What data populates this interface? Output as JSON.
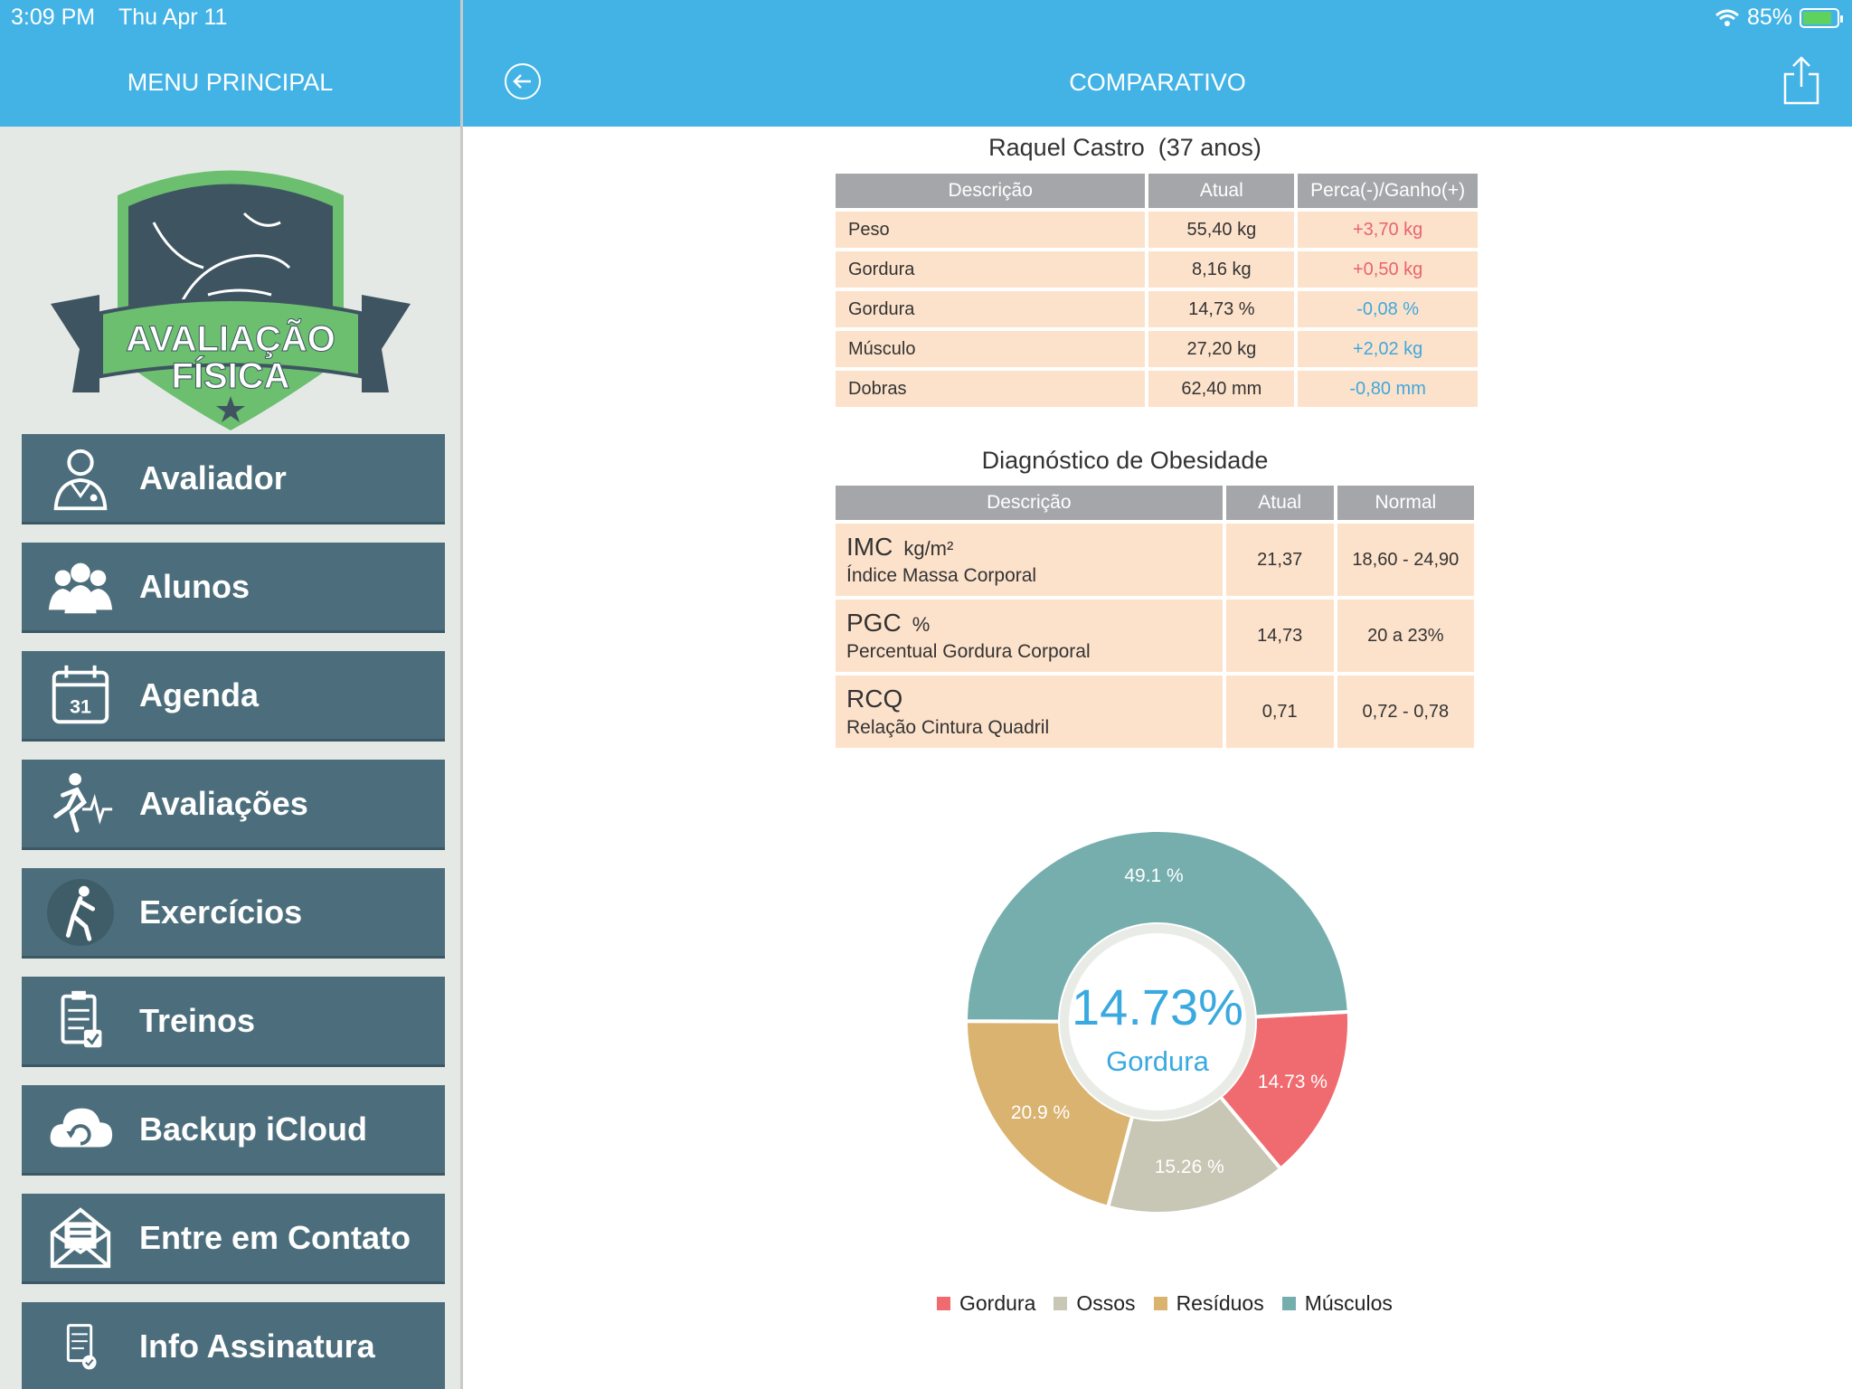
{
  "status": {
    "time": "3:09 PM",
    "date": "Thu Apr 11",
    "battery": "85%"
  },
  "left": {
    "title": "MENU PRINCIPAL",
    "logo": {
      "line1": "AVALIAÇÃO",
      "line2": "FÍSICA"
    },
    "menu": [
      {
        "label": "Avaliador",
        "icon": "doctor-icon"
      },
      {
        "label": "Alunos",
        "icon": "users-icon"
      },
      {
        "label": "Agenda",
        "icon": "calendar-icon",
        "icon_text": "31"
      },
      {
        "label": "Avaliações",
        "icon": "runner-heartbeat-icon"
      },
      {
        "label": "Exercícios",
        "icon": "exercise-icon"
      },
      {
        "label": "Treinos",
        "icon": "clipboard-icon"
      },
      {
        "label": "Backup iCloud",
        "icon": "cloud-sync-icon"
      },
      {
        "label": "Entre em Contato",
        "icon": "mail-icon"
      },
      {
        "label": "Info Assinatura",
        "icon": "subscription-icon"
      }
    ]
  },
  "right": {
    "title": "COMPARATIVO",
    "person": {
      "name": "Raquel Castro",
      "age": "(37 anos)"
    },
    "comparison": {
      "headers": [
        "Descrição",
        "Atual",
        "Perca(-)/Ganho(+)"
      ],
      "rows": [
        {
          "desc": "Peso",
          "current": "55,40 kg",
          "change": "+3,70 kg",
          "trend": "up"
        },
        {
          "desc": "Gordura",
          "current": "8,16 kg",
          "change": "+0,50 kg",
          "trend": "up"
        },
        {
          "desc": "Gordura",
          "current": "14,73 %",
          "change": "-0,08 %",
          "trend": "down"
        },
        {
          "desc": "Músculo",
          "current": "27,20 kg",
          "change": "+2,02 kg",
          "trend": "down"
        },
        {
          "desc": "Dobras",
          "current": "62,40 mm",
          "change": "-0,80 mm",
          "trend": "down"
        }
      ]
    },
    "obesity": {
      "title": "Diagnóstico de Obesidade",
      "headers": [
        "Descrição",
        "Atual",
        "Normal"
      ],
      "rows": [
        {
          "abbr": "IMC",
          "unit": "kg/m²",
          "name": "Índice Massa Corporal",
          "current": "21,37",
          "normal": "18,60 - 24,90"
        },
        {
          "abbr": "PGC",
          "unit": "%",
          "name": "Percentual Gordura Corporal",
          "current": "14,73",
          "normal": "20 a 23%"
        },
        {
          "abbr": "RCQ",
          "unit": "",
          "name": "Relação Cintura Quadril",
          "current": "0,71",
          "normal": "0,72 - 0,78"
        }
      ]
    }
  },
  "chart_data": {
    "type": "pie",
    "center_value": "14.73%",
    "center_label": "Gordura",
    "slices": [
      {
        "name": "Gordura",
        "value": 14.73,
        "label": "14.73 %",
        "color": "#f06b70"
      },
      {
        "name": "Ossos",
        "value": 15.26,
        "label": "15.26 %",
        "color": "#c8c6b4"
      },
      {
        "name": "Resíduos",
        "value": 20.9,
        "label": "20.9 %",
        "color": "#d9b36f"
      },
      {
        "name": "Músculos",
        "value": 49.1,
        "label": "49.1 %",
        "color": "#76aeae"
      }
    ],
    "legend": [
      "Gordura",
      "Ossos",
      "Resíduos",
      "Músculos"
    ],
    "colors": {
      "center_text": "#3aa9df"
    }
  }
}
